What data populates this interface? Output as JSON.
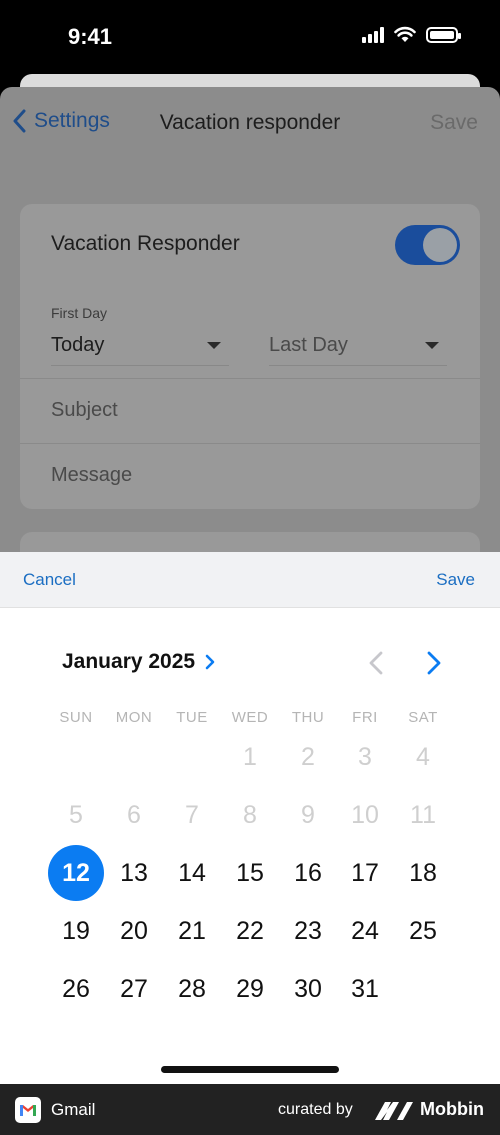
{
  "status_bar": {
    "time": "9:41",
    "signal_icon": "cellular-signal-icon",
    "wifi_icon": "wifi-icon",
    "battery_icon": "battery-icon"
  },
  "nav": {
    "back_label": "Settings",
    "title": "Vacation responder",
    "save_label": "Save"
  },
  "responder": {
    "toggle_label": "Vacation Responder",
    "toggle_on": true,
    "first_day_caption": "First Day",
    "first_day_value": "Today",
    "last_day_placeholder": "Last Day",
    "subject_placeholder": "Subject",
    "message_placeholder": "Message"
  },
  "picker": {
    "cancel_label": "Cancel",
    "save_label": "Save",
    "month_label": "January 2025",
    "weekdays": [
      "SUN",
      "MON",
      "TUE",
      "WED",
      "THU",
      "FRI",
      "SAT"
    ],
    "selected_day": "12",
    "days": [
      [
        "",
        "",
        "",
        "1",
        "2",
        "3",
        "4"
      ],
      [
        "5",
        "6",
        "7",
        "8",
        "9",
        "10",
        "11"
      ],
      [
        "12",
        "13",
        "14",
        "15",
        "16",
        "17",
        "18"
      ],
      [
        "19",
        "20",
        "21",
        "22",
        "23",
        "24",
        "25"
      ],
      [
        "26",
        "27",
        "28",
        "29",
        "30",
        "31",
        ""
      ]
    ],
    "disabled_days": [
      "1",
      "2",
      "3",
      "4",
      "5",
      "6",
      "7",
      "8",
      "9",
      "10",
      "11"
    ]
  },
  "footer": {
    "app_name": "Gmail",
    "curated_by": "curated by",
    "brand": "Mobbin"
  },
  "colors": {
    "accent": "#0b7cf2",
    "link": "#1b6ec2",
    "toggle_on": "#1a4d9c"
  }
}
